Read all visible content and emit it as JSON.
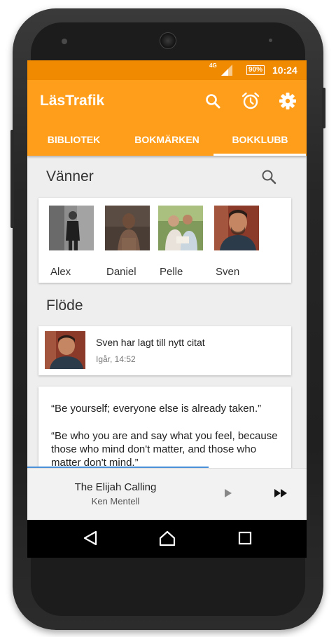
{
  "status_bar": {
    "network": "4G",
    "battery": "90%",
    "time": "10:24",
    "color": "#f08a00"
  },
  "app_bar": {
    "title": "LäsTrafik",
    "color": "#ff9e1b",
    "actions": [
      "search-icon",
      "alarm-clock-icon",
      "gear-icon"
    ]
  },
  "tabs": [
    {
      "label": "BIBLIOTEK",
      "selected": false
    },
    {
      "label": "BOKMÄRKEN",
      "selected": false
    },
    {
      "label": "BOKKLUBB",
      "selected": true
    }
  ],
  "friends": {
    "title": "Vänner",
    "items": [
      {
        "name": "Alex"
      },
      {
        "name": "Daniel"
      },
      {
        "name": "Pelle"
      },
      {
        "name": "Sven"
      }
    ]
  },
  "feed": {
    "title": "Flöde",
    "items": [
      {
        "text": "Sven har lagt till nytt citat",
        "time": "Igår, 14:52"
      }
    ],
    "quote": {
      "line1": "“Be yourself; everyone else is already taken.”",
      "line2": "“Be who you are and say what you feel, because those who mind don't matter, and those who matter don't mind.”"
    }
  },
  "player": {
    "title": "The Elijah Calling",
    "artist": "Ken Mentell",
    "progress": 0.65
  },
  "nav": [
    "back-icon",
    "home-icon",
    "recents-icon"
  ]
}
